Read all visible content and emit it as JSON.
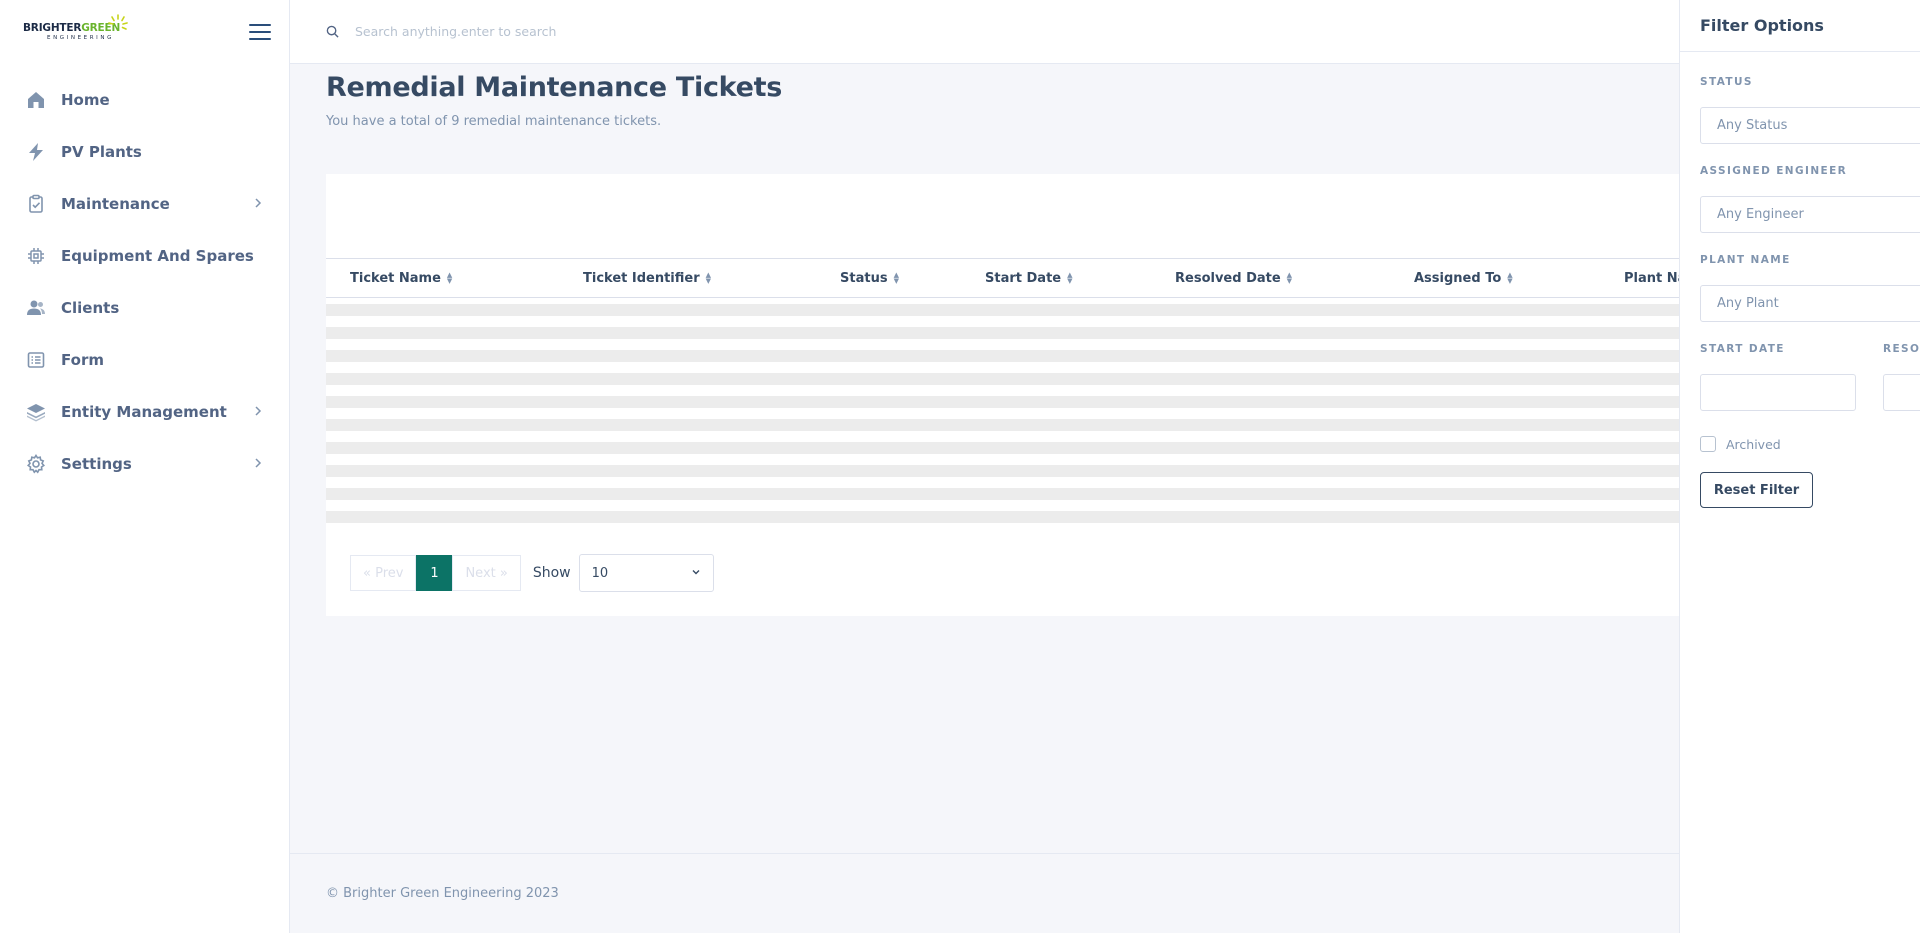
{
  "brand": {
    "logo_word1": "BRIGHTER",
    "logo_word2": "GREEN",
    "logo_sub": "ENGINEERING",
    "accent_color": "#6ab42d"
  },
  "sidebar": {
    "items": [
      {
        "label": "Home",
        "icon": "home-icon"
      },
      {
        "label": "PV Plants",
        "icon": "lightning-icon"
      },
      {
        "label": "Maintenance",
        "icon": "clipboard-check-icon",
        "has_submenu": true
      },
      {
        "label": "Equipment And Spares",
        "icon": "chip-icon"
      },
      {
        "label": "Clients",
        "icon": "users-icon"
      },
      {
        "label": "Form",
        "icon": "form-icon"
      },
      {
        "label": "Entity Management",
        "icon": "layers-icon",
        "has_submenu": true
      },
      {
        "label": "Settings",
        "icon": "gear-icon",
        "has_submenu": true
      }
    ]
  },
  "search": {
    "placeholder": "Search anything.enter to search"
  },
  "page": {
    "title": "Remedial Maintenance Tickets",
    "subtitle": "You have a total of 9 remedial maintenance tickets."
  },
  "table": {
    "columns": [
      "Ticket Name",
      "Ticket Identifier",
      "Status",
      "Start Date",
      "Resolved Date",
      "Assigned To",
      "Plant Na"
    ]
  },
  "pagination": {
    "prev": "« Prev",
    "current": "1",
    "next": "Next »",
    "show_label": "Show",
    "page_size": "10"
  },
  "footer": {
    "text": "© Brighter Green Engineering 2023"
  },
  "filter": {
    "title": "Filter Options",
    "status_label": "STATUS",
    "status_placeholder": "Any Status",
    "engineer_label": "ASSIGNED ENGINEER",
    "engineer_placeholder": "Any Engineer",
    "plant_label": "PLANT NAME",
    "plant_placeholder": "Any Plant",
    "start_date_label": "START DATE",
    "resolved_date_label": "RESOL",
    "archived_label": "Archived",
    "reset_label": "Reset Filter"
  },
  "colors": {
    "primary": "#0c7366",
    "text": "#364a63",
    "muted": "#8094ae"
  }
}
